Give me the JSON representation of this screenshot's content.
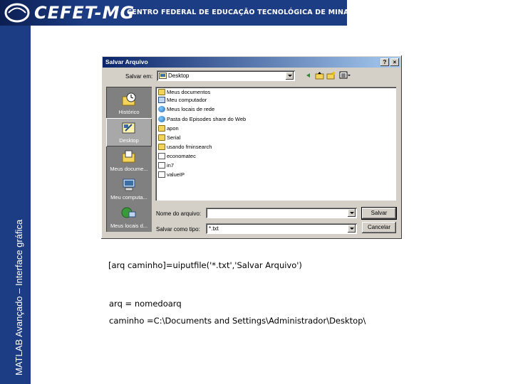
{
  "banner": {
    "logo_text": "CEFET-MG",
    "subtitle": "CENTRO FEDERAL DE EDUCAÇÃO TECNOLÓGICA DE MINAS GERAIS"
  },
  "sidebar": {
    "title": "MATLAB Avançado – Interface gráfica"
  },
  "dialog": {
    "title": "Salvar Arquivo",
    "help_button": "?",
    "close_button": "×",
    "save_in_label": "Salvar em:",
    "save_in_value": "Desktop",
    "places": [
      {
        "label": "Histórico",
        "icon": "history-icon"
      },
      {
        "label": "Desktop",
        "icon": "desktop-icon"
      },
      {
        "label": "Meus docume...",
        "icon": "my-documents-icon"
      },
      {
        "label": "Meu computa...",
        "icon": "my-computer-icon"
      },
      {
        "label": "Meus locais d...",
        "icon": "network-places-icon"
      }
    ],
    "files": [
      {
        "name": "Meus documentos",
        "icon": "folder-icon"
      },
      {
        "name": "Meu computador",
        "icon": "computer-icon"
      },
      {
        "name": "Meus locais de rede",
        "icon": "network-icon"
      },
      {
        "name": "Pasta do Episodes share do Web",
        "icon": "web-folder-icon"
      },
      {
        "name": "apon",
        "icon": "folder-icon"
      },
      {
        "name": "Serial",
        "icon": "folder-icon"
      },
      {
        "name": "usando fminsearch",
        "icon": "folder-icon"
      },
      {
        "name": "economatec",
        "icon": "document-icon"
      },
      {
        "name": "in7",
        "icon": "document-icon"
      },
      {
        "name": "valueIP",
        "icon": "document-icon"
      }
    ],
    "filename_label": "Nome do arquivo:",
    "filename_value": "",
    "filetype_label": "Salvar como tipo:",
    "filetype_value": "*.txt",
    "save_button": "Salvar",
    "cancel_button": "Cancelar"
  },
  "code_lines": {
    "line1": "[arq caminho]=uiputfile('*.txt','Salvar Arquivo')",
    "line2": "arq = nomedoarq",
    "line3": "caminho =C:\\Documents and Settings\\Administrador\\Desktop\\"
  }
}
